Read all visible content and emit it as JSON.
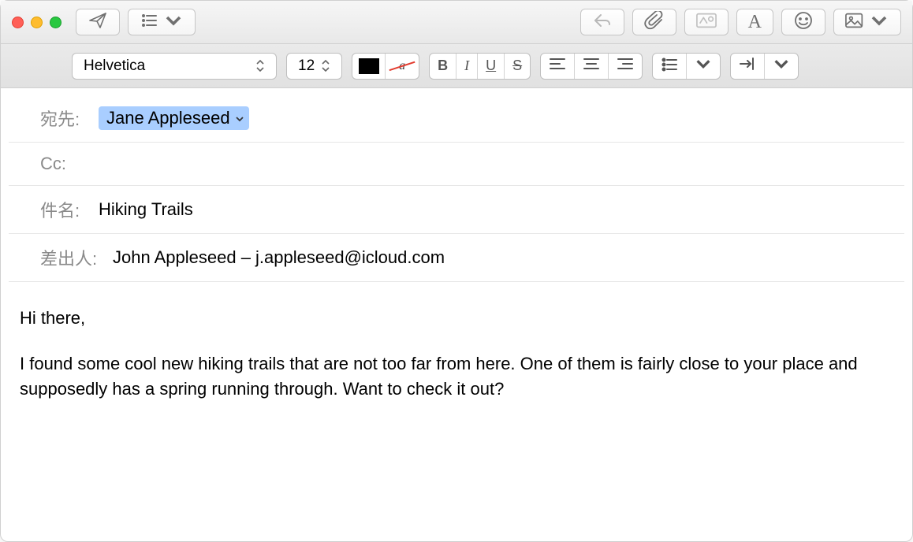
{
  "toolbar": {
    "format": {
      "font": "Helvetica",
      "size": "12",
      "bold": "B",
      "italic": "I",
      "underline": "U",
      "strike": "S"
    }
  },
  "headers": {
    "to_label": "宛先:",
    "to_recipient": "Jane Appleseed",
    "cc_label": "Cc:",
    "subject_label": "件名:",
    "subject_value": "Hiking Trails",
    "from_label": "差出人:",
    "from_value": "John Appleseed – j.appleseed@icloud.com"
  },
  "message": {
    "greeting": "Hi there,",
    "body": "I found some cool new hiking trails that are not too far from here. One of them is fairly close to your place and supposedly has a spring running through. Want to check it out?"
  }
}
